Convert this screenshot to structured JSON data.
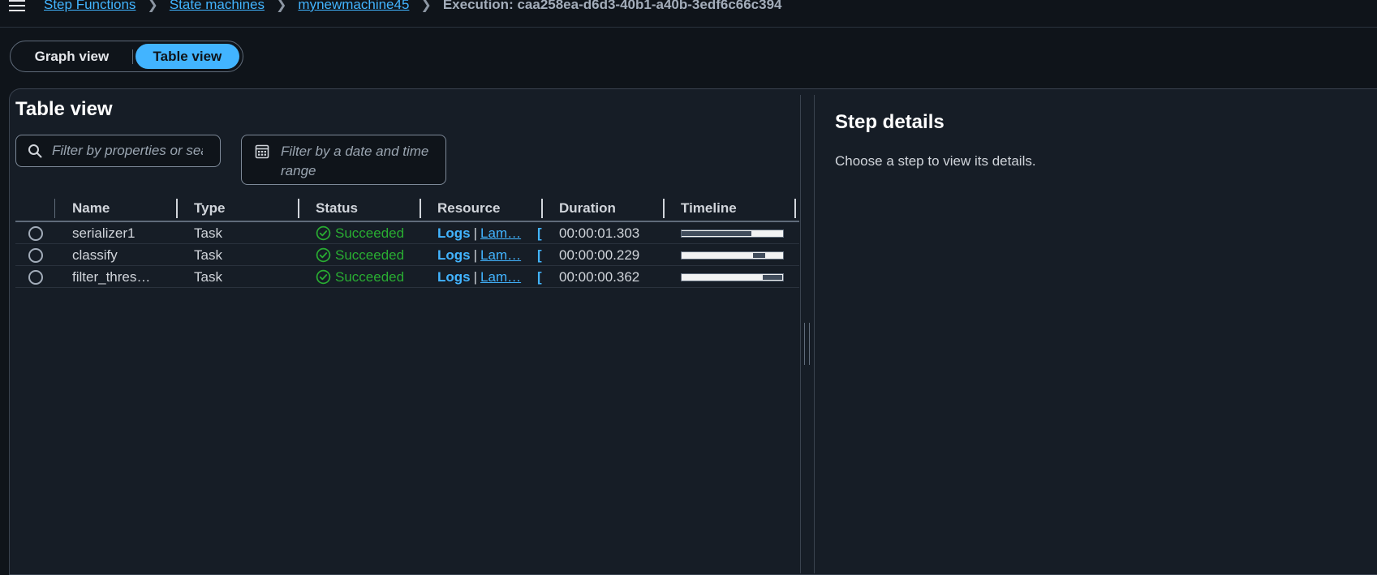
{
  "breadcrumb": {
    "items": [
      "Step Functions",
      "State machines",
      "mynewmachine45"
    ],
    "current": "Execution: caa258ea-d6d3-40b1-a40b-3edf6c66c394",
    "separator": ">"
  },
  "view_toggle": {
    "graph_label": "Graph view",
    "table_label": "Table view",
    "selected": "Table view"
  },
  "table_panel": {
    "title": "Table view",
    "search_placeholder": "Filter by properties or search",
    "date_filter_label": "Filter by a date and time range"
  },
  "table": {
    "columns": [
      "Name",
      "Type",
      "Status",
      "Resource",
      "Duration",
      "Timeline"
    ],
    "rows": [
      {
        "name": "serializer1",
        "type": "Task",
        "status": "Succeeded",
        "logs": "Logs",
        "resource_link": "Lam…",
        "duration": "00:00:01.303",
        "timeline_start": 0.0,
        "timeline_end": 0.69
      },
      {
        "name": "classify",
        "type": "Task",
        "status": "Succeeded",
        "logs": "Logs",
        "resource_link": "Lam…",
        "duration": "00:00:00.229",
        "timeline_start": 0.7,
        "timeline_end": 0.82
      },
      {
        "name": "filter_thres…",
        "type": "Task",
        "status": "Succeeded",
        "logs": "Logs",
        "resource_link": "Lam…",
        "duration": "00:00:00.362",
        "timeline_start": 0.8,
        "timeline_end": 0.99
      }
    ]
  },
  "details": {
    "title": "Step details",
    "hint": "Choose a step to view its details."
  },
  "colors": {
    "accent": "#42b4ff",
    "success": "#29ad32",
    "background": "#0f141a",
    "panel": "#161d26"
  }
}
